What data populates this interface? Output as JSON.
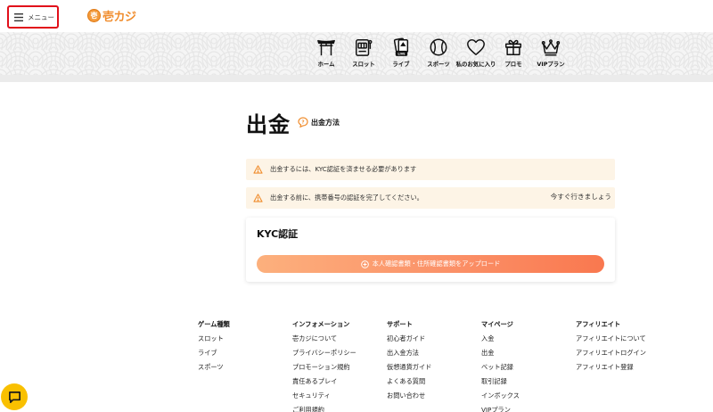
{
  "header": {
    "menu_label": "メニュー",
    "logo_coin": "壱",
    "logo_text": "壱カジ",
    "nav": [
      {
        "label": "ホーム",
        "icon": "torii-gate-icon"
      },
      {
        "label": "スロット",
        "icon": "slot-machine-icon"
      },
      {
        "label": "ライブ",
        "icon": "live-cards-icon"
      },
      {
        "label": "スポーツ",
        "icon": "baseball-icon"
      },
      {
        "label": "私のお気に入り",
        "icon": "heart-icon"
      },
      {
        "label": "プロモ",
        "icon": "gift-icon"
      },
      {
        "label": "VIPプラン",
        "icon": "crown-icon"
      }
    ]
  },
  "main": {
    "title": "出金",
    "howto_label": "出金方法",
    "alerts": [
      {
        "text": "出金するには、KYC認証を済ませる必要があります"
      },
      {
        "text": "出金する前に、携帯番号の認証を完了してください。",
        "link": "今すぐ行きましょう"
      }
    ],
    "kyc": {
      "title": "KYC認証",
      "upload_label": "本人確認書類・住所確認書類をアップロード"
    }
  },
  "footer": {
    "columns": [
      {
        "heading": "ゲーム種類",
        "items": [
          "スロット",
          "ライブ",
          "スポーツ"
        ]
      },
      {
        "heading": "インフォメーション",
        "items": [
          "壱カジについて",
          "プライバシーポリシー",
          "プロモーション規約",
          "責任あるプレイ",
          "セキュリティ",
          "ご利用規約"
        ]
      },
      {
        "heading": "サポート",
        "items": [
          "初心者ガイド",
          "出入金方法",
          "仮想通貨ガイド",
          "よくある質問",
          "お問い合わせ"
        ]
      },
      {
        "heading": "マイページ",
        "items": [
          "入金",
          "出金",
          "ベット記録",
          "取引記録",
          "インボックス",
          "VIPプラン"
        ]
      },
      {
        "heading": "アフィリエイト",
        "items": [
          "アフィリエイトについて",
          "アフィリエイトログイン",
          "アフィリエイト登録"
        ]
      }
    ]
  },
  "colors": {
    "accent_orange": "#f08c2c",
    "alert_bg": "#fdf4e6",
    "menu_highlight": "#e10f1a",
    "chat_button": "#f9c000"
  }
}
